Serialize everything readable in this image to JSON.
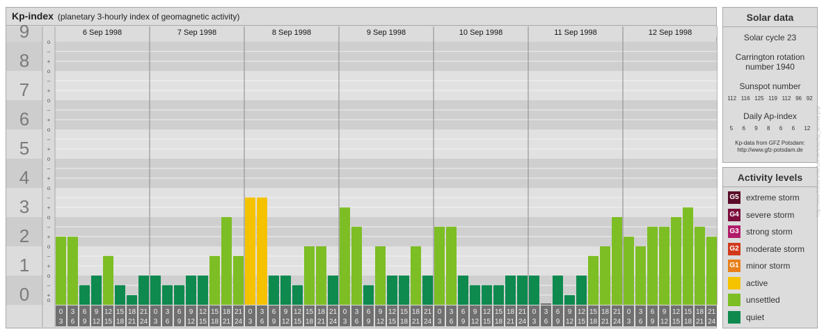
{
  "header": {
    "title": "Kp-index",
    "subtitle": "(planetary 3-hourly index of geomagnetic activity)"
  },
  "chart_data": {
    "type": "bar",
    "ylim": [
      0,
      9
    ],
    "y_tick_labels": [
      "0",
      "1",
      "2",
      "3",
      "4",
      "5",
      "6",
      "7",
      "8",
      "9"
    ],
    "y_subtick_labels": [
      "o",
      "+",
      "–"
    ],
    "days": [
      "6 Sep 1998",
      "7 Sep 1998",
      "8 Sep 1998",
      "9 Sep 1998",
      "10 Sep 1998",
      "11 Sep 1998",
      "12 Sep 1998"
    ],
    "hour_start_labels": [
      "0",
      "3",
      "6",
      "9",
      "12",
      "15",
      "18",
      "21"
    ],
    "hour_end_labels": [
      "3",
      "6",
      "9",
      "12",
      "15",
      "18",
      "21",
      "24"
    ],
    "values": [
      [
        2.33,
        2.33,
        0.67,
        1.0,
        1.67,
        0.67,
        0.33,
        1.0
      ],
      [
        1.0,
        0.67,
        0.67,
        1.0,
        1.0,
        1.67,
        3.0,
        1.67
      ],
      [
        3.67,
        3.67,
        1.0,
        1.0,
        0.67,
        2.0,
        2.0,
        1.0
      ],
      [
        3.33,
        2.67,
        0.67,
        2.0,
        1.0,
        1.0,
        2.0,
        1.0
      ],
      [
        2.67,
        2.67,
        1.0,
        0.67,
        0.67,
        0.67,
        1.0,
        1.0
      ],
      [
        1.0,
        0.0,
        1.0,
        0.33,
        1.0,
        1.67,
        2.0,
        3.0
      ],
      [
        2.33,
        2.0,
        2.67,
        2.67,
        3.0,
        3.33,
        2.67,
        2.33
      ]
    ],
    "colors": {
      "quiet": "#0e8a4f",
      "unsettled": "#7dbe24",
      "active": "#f5c200",
      "zero": "#6f6f6f"
    },
    "grid": true
  },
  "solar_panel": {
    "heading": "Solar data",
    "cycle": "Solar cycle 23",
    "carrington_line1": "Carrington rotation",
    "carrington_line2": "number 1940",
    "sunspot_label": "Sunspot number",
    "sunspot_values": [
      "112",
      "116",
      "125",
      "119",
      "112",
      "96",
      "92"
    ],
    "ap_label": "Daily Ap-index",
    "ap_values": [
      "5",
      "6",
      "9",
      "8",
      "6",
      "6",
      "12"
    ],
    "credit_line1": "Kp-data from GFZ Potsdam:",
    "credit_line2": "http://www.gfz-potsdam.de"
  },
  "activity_panel": {
    "heading": "Activity levels",
    "levels": [
      {
        "badge": "G5",
        "label": "extreme storm",
        "color": "#5a0a28"
      },
      {
        "badge": "G4",
        "label": "severe storm",
        "color": "#7c0c3c"
      },
      {
        "badge": "G3",
        "label": "strong storm",
        "color": "#b01c6a"
      },
      {
        "badge": "G2",
        "label": "moderate storm",
        "color": "#d23a1c"
      },
      {
        "badge": "G1",
        "label": "minor storm",
        "color": "#e8801a"
      },
      {
        "badge": "",
        "label": "active",
        "color": "#f5c200"
      },
      {
        "badge": "",
        "label": "unsettled",
        "color": "#7dbe24"
      },
      {
        "badge": "",
        "label": "quiet",
        "color": "#0e8a4f"
      }
    ]
  },
  "watermark": "http://www.theiss-unterfuhr.de/solar/kp_archive.php"
}
